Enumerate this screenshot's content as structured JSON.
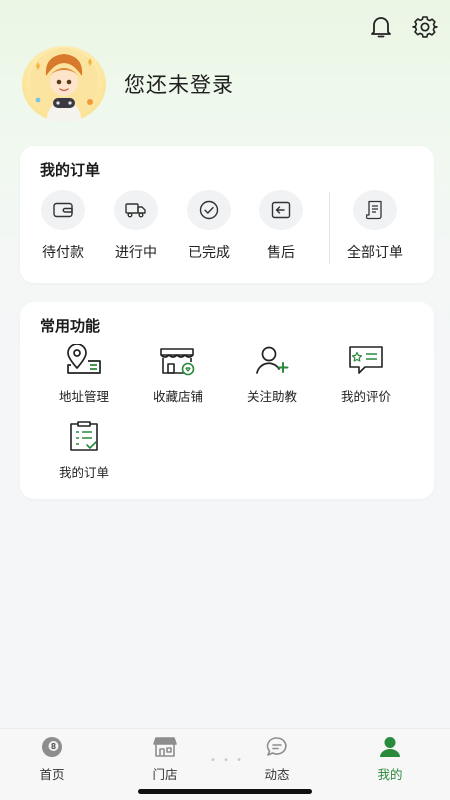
{
  "header": {
    "icons": [
      "bell-icon",
      "gear-icon"
    ]
  },
  "profile": {
    "login_text": "您还未登录"
  },
  "orders": {
    "title": "我的订单",
    "items": [
      {
        "label": "待付款",
        "icon": "wallet-icon"
      },
      {
        "label": "进行中",
        "icon": "truck-icon"
      },
      {
        "label": "已完成",
        "icon": "check-circle-icon"
      },
      {
        "label": "售后",
        "icon": "return-icon"
      },
      {
        "label": "全部订单",
        "icon": "receipt-icon"
      }
    ]
  },
  "functions": {
    "title": "常用功能",
    "items": [
      {
        "label": "地址管理",
        "icon": "address-icon"
      },
      {
        "label": "收藏店铺",
        "icon": "favorite-store-icon"
      },
      {
        "label": "关注助教",
        "icon": "follow-user-icon"
      },
      {
        "label": "我的评价",
        "icon": "review-icon"
      },
      {
        "label": "我的订单",
        "icon": "order-list-icon"
      }
    ]
  },
  "tabbar": {
    "items": [
      {
        "label": "首页",
        "icon": "billiard-ball-icon"
      },
      {
        "label": "门店",
        "icon": "store-icon"
      },
      {
        "label": "动态",
        "icon": "chat-bubble-icon"
      },
      {
        "label": "我的",
        "icon": "user-icon"
      }
    ],
    "active_index": 3,
    "accent": "#2a8a3c"
  }
}
